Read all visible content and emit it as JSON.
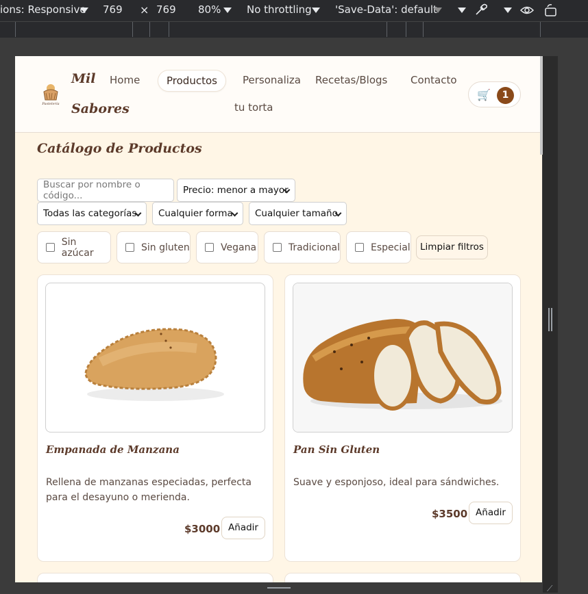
{
  "devtools": {
    "dimensions_label": "ions: Responsive",
    "width": "769",
    "times": "×",
    "height": "769",
    "zoom": "80%",
    "throttling": "No throttling",
    "save_data": "'Save-Data': default"
  },
  "header": {
    "brand_line1": "Mil",
    "brand_line2": "Sabores",
    "nav": {
      "home": "Home",
      "productos": "Productos",
      "personaliza_line1": "Personaliza",
      "personaliza_line2": "tu torta",
      "recetas": "Recetas/Blogs",
      "contacto": "Contacto"
    },
    "cart_count": "1"
  },
  "catalog": {
    "title": "Catálogo de Productos",
    "search_placeholder": "Buscar por nombre o código...",
    "sort_select": "Precio: menor a mayor",
    "category_select": "Todas las categorías",
    "shape_select": "Cualquier forma",
    "size_select": "Cualquier tamaño",
    "filters": {
      "sin_azucar": "Sin azúcar",
      "sin_gluten": "Sin gluten",
      "vegana": "Vegana",
      "tradicional": "Tradicional",
      "especial": "Especial"
    },
    "clear_filters": "Limpiar filtros"
  },
  "products": [
    {
      "name": "Empanada de Manzana",
      "description": "Rellena de manzanas especiadas, perfecta para el desayuno o merienda.",
      "price": "$3000",
      "add_label": "Añadir"
    },
    {
      "name": "Pan Sin Gluten",
      "description": "Suave y esponjoso, ideal para sándwiches.",
      "price": "$3500",
      "add_label": "Añadir"
    }
  ]
}
